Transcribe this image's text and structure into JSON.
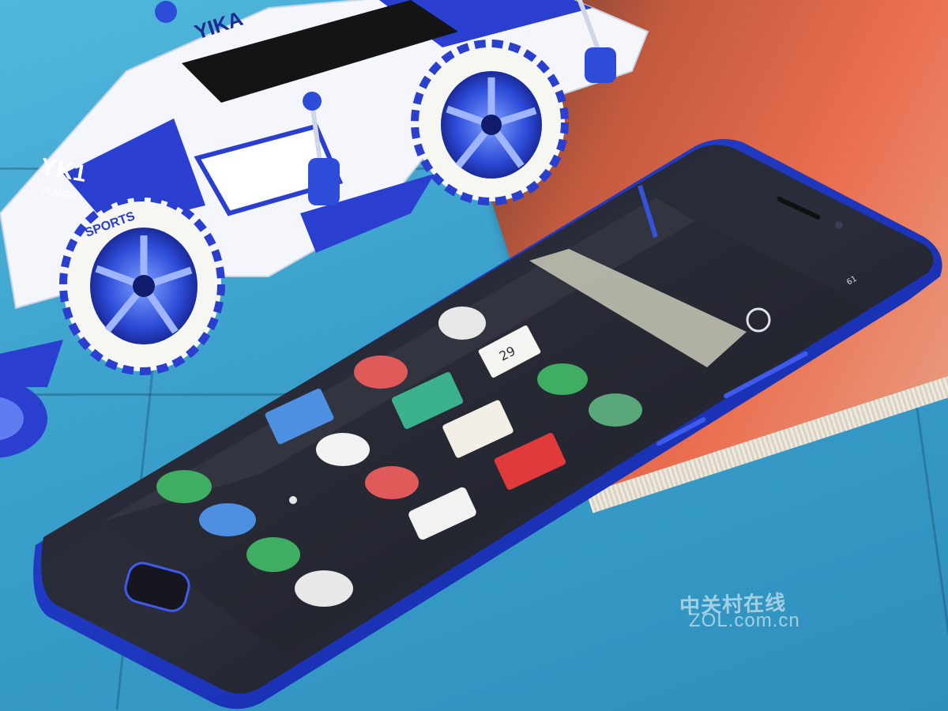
{
  "scene": {
    "description_colors": {
      "table": "#3fa6cf",
      "phone_frame": "#1b33b8",
      "screen": "#1d1f2b",
      "magazine": "#ea6e4f"
    }
  },
  "toy_car": {
    "brand_text": "YIKA",
    "model_text": "YK1",
    "sub_text": "POWER",
    "wheel_text": "SPORTS"
  },
  "phone": {
    "status_time": "61",
    "calendar_day": "29",
    "apps": [
      {
        "icon": "clock-icon",
        "color": "#e8e8e8"
      },
      {
        "icon": "calendar-icon",
        "color": "#f4f4f0"
      },
      {
        "icon": "music-icon",
        "color": "#e05a5a"
      },
      {
        "icon": "video-icon",
        "color": "#3bb18e"
      },
      {
        "icon": "umbrella-icon",
        "color": "#3fae62"
      },
      {
        "icon": "app-store-icon",
        "color": "#4d8fe0"
      },
      {
        "icon": "news-icon",
        "color": "#f2efe6"
      },
      {
        "icon": "settings-icon",
        "color": "#5aa77a"
      },
      {
        "icon": "game-center-icon",
        "color": "#f2f2f2"
      },
      {
        "icon": "gallery-icon",
        "color": "#e03a3a"
      },
      {
        "icon": "phone-icon",
        "color": "#3fae62"
      },
      {
        "icon": "life-service-icon",
        "color": "#e05a5a"
      },
      {
        "icon": "compass-icon",
        "color": "#4d8fe0"
      },
      {
        "icon": "theme-icon",
        "color": "#f2f2f2"
      },
      {
        "icon": "message-icon",
        "color": "#3fae62"
      },
      {
        "icon": "camera-icon",
        "color": "#e8e8e8"
      }
    ]
  },
  "watermark": {
    "line1": "中关村在线",
    "line2": "ZOL.com.cn"
  }
}
